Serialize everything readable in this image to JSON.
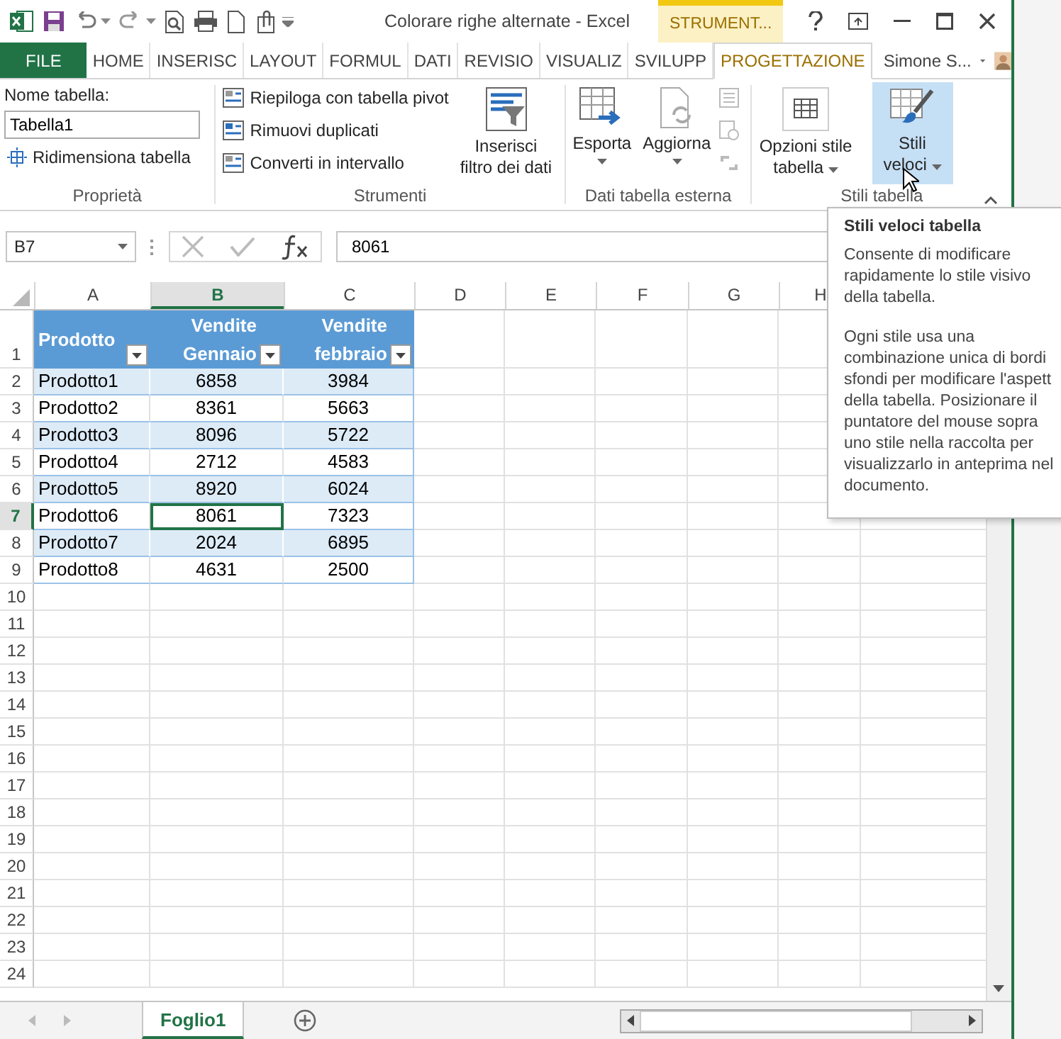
{
  "window": {
    "title": "Colorare righe alternate - Excel",
    "contextual_label": "STRUMENT...",
    "user": "Simone S..."
  },
  "ribbon_tabs": [
    {
      "label": "FILE",
      "kind": "file",
      "selected": false
    },
    {
      "label": "HOME",
      "kind": "tab",
      "selected": false
    },
    {
      "label": "INSERISC",
      "kind": "tab",
      "selected": false
    },
    {
      "label": "LAYOUT",
      "kind": "tab",
      "selected": false
    },
    {
      "label": "FORMUL",
      "kind": "tab",
      "selected": false
    },
    {
      "label": "DATI",
      "kind": "tab",
      "selected": false
    },
    {
      "label": "REVISIO",
      "kind": "tab",
      "selected": false
    },
    {
      "label": "VISUALIZ",
      "kind": "tab",
      "selected": false
    },
    {
      "label": "SVILUPP",
      "kind": "tab",
      "selected": false
    },
    {
      "label": "PROGETTAZIONE",
      "kind": "contextual",
      "selected": true
    }
  ],
  "ribbon": {
    "properties": {
      "name_label": "Nome tabella:",
      "name_value": "Tabella1",
      "resize": "Ridimensiona tabella",
      "group": "Proprietà"
    },
    "tools": {
      "items": [
        "Riepiloga con tabella pivot",
        "Rimuovi duplicati",
        "Converti in intervallo"
      ],
      "slicer": [
        "Inserisci",
        "filtro dei dati"
      ],
      "group": "Strumenti"
    },
    "external": {
      "export": "Esporta",
      "refresh": "Aggiorna",
      "group": "Dati tabella esterna"
    },
    "styles": {
      "options": [
        "Opzioni stile",
        "tabella"
      ],
      "quick": [
        "Stili",
        "veloci"
      ],
      "quick_pressed": true,
      "group": "Stili tabella"
    }
  },
  "formula_bar": {
    "name_box": "B7",
    "formula": "8061"
  },
  "columns": [
    {
      "label": "A",
      "selected": false
    },
    {
      "label": "B",
      "selected": true
    },
    {
      "label": "C",
      "selected": false
    },
    {
      "label": "D",
      "selected": false
    },
    {
      "label": "E",
      "selected": false
    },
    {
      "label": "F",
      "selected": false
    },
    {
      "label": "G",
      "selected": false
    },
    {
      "label": "H",
      "selected": false
    }
  ],
  "table": {
    "headers": [
      [
        "Prodotto"
      ],
      [
        "Vendite",
        "Gennaio"
      ],
      [
        "Vendite",
        "febbraio"
      ]
    ],
    "rows": [
      [
        "Prodotto1",
        "6858",
        "3984"
      ],
      [
        "Prodotto2",
        "8361",
        "5663"
      ],
      [
        "Prodotto3",
        "8096",
        "5722"
      ],
      [
        "Prodotto4",
        "2712",
        "4583"
      ],
      [
        "Prodotto5",
        "8920",
        "6024"
      ],
      [
        "Prodotto6",
        "8061",
        "7323"
      ],
      [
        "Prodotto7",
        "2024",
        "6895"
      ],
      [
        "Prodotto8",
        "4631",
        "2500"
      ]
    ]
  },
  "row_headers": [
    {
      "label": "1",
      "selected": false
    },
    {
      "label": "2",
      "selected": false
    },
    {
      "label": "3",
      "selected": false
    },
    {
      "label": "4",
      "selected": false
    },
    {
      "label": "5",
      "selected": false
    },
    {
      "label": "6",
      "selected": false
    },
    {
      "label": "7",
      "selected": true
    },
    {
      "label": "8",
      "selected": false
    },
    {
      "label": "9",
      "selected": false
    },
    {
      "label": "10",
      "selected": false
    },
    {
      "label": "11",
      "selected": false
    },
    {
      "label": "12",
      "selected": false
    },
    {
      "label": "13",
      "selected": false
    },
    {
      "label": "14",
      "selected": false
    },
    {
      "label": "15",
      "selected": false
    },
    {
      "label": "16",
      "selected": false
    },
    {
      "label": "17",
      "selected": false
    },
    {
      "label": "18",
      "selected": false
    },
    {
      "label": "19",
      "selected": false
    },
    {
      "label": "20",
      "selected": false
    },
    {
      "label": "21",
      "selected": false
    },
    {
      "label": "22",
      "selected": false
    },
    {
      "label": "23",
      "selected": false
    },
    {
      "label": "24",
      "selected": false
    }
  ],
  "sheet_tabs": [
    {
      "label": "Foglio1",
      "selected": true
    }
  ],
  "tooltip": {
    "title": "Stili veloci tabella",
    "paragraphs": [
      [
        "Consente di modificare",
        "rapidamente lo stile visivo",
        "della tabella."
      ],
      [
        "Ogni stile usa una",
        "combinazione unica di bordi",
        "sfondi per modificare l'aspett",
        "della tabella. Posizionare il",
        "puntatore del mouse sopra",
        "uno stile nella raccolta per",
        "visualizzarlo in anteprima nel",
        "documento."
      ]
    ]
  }
}
